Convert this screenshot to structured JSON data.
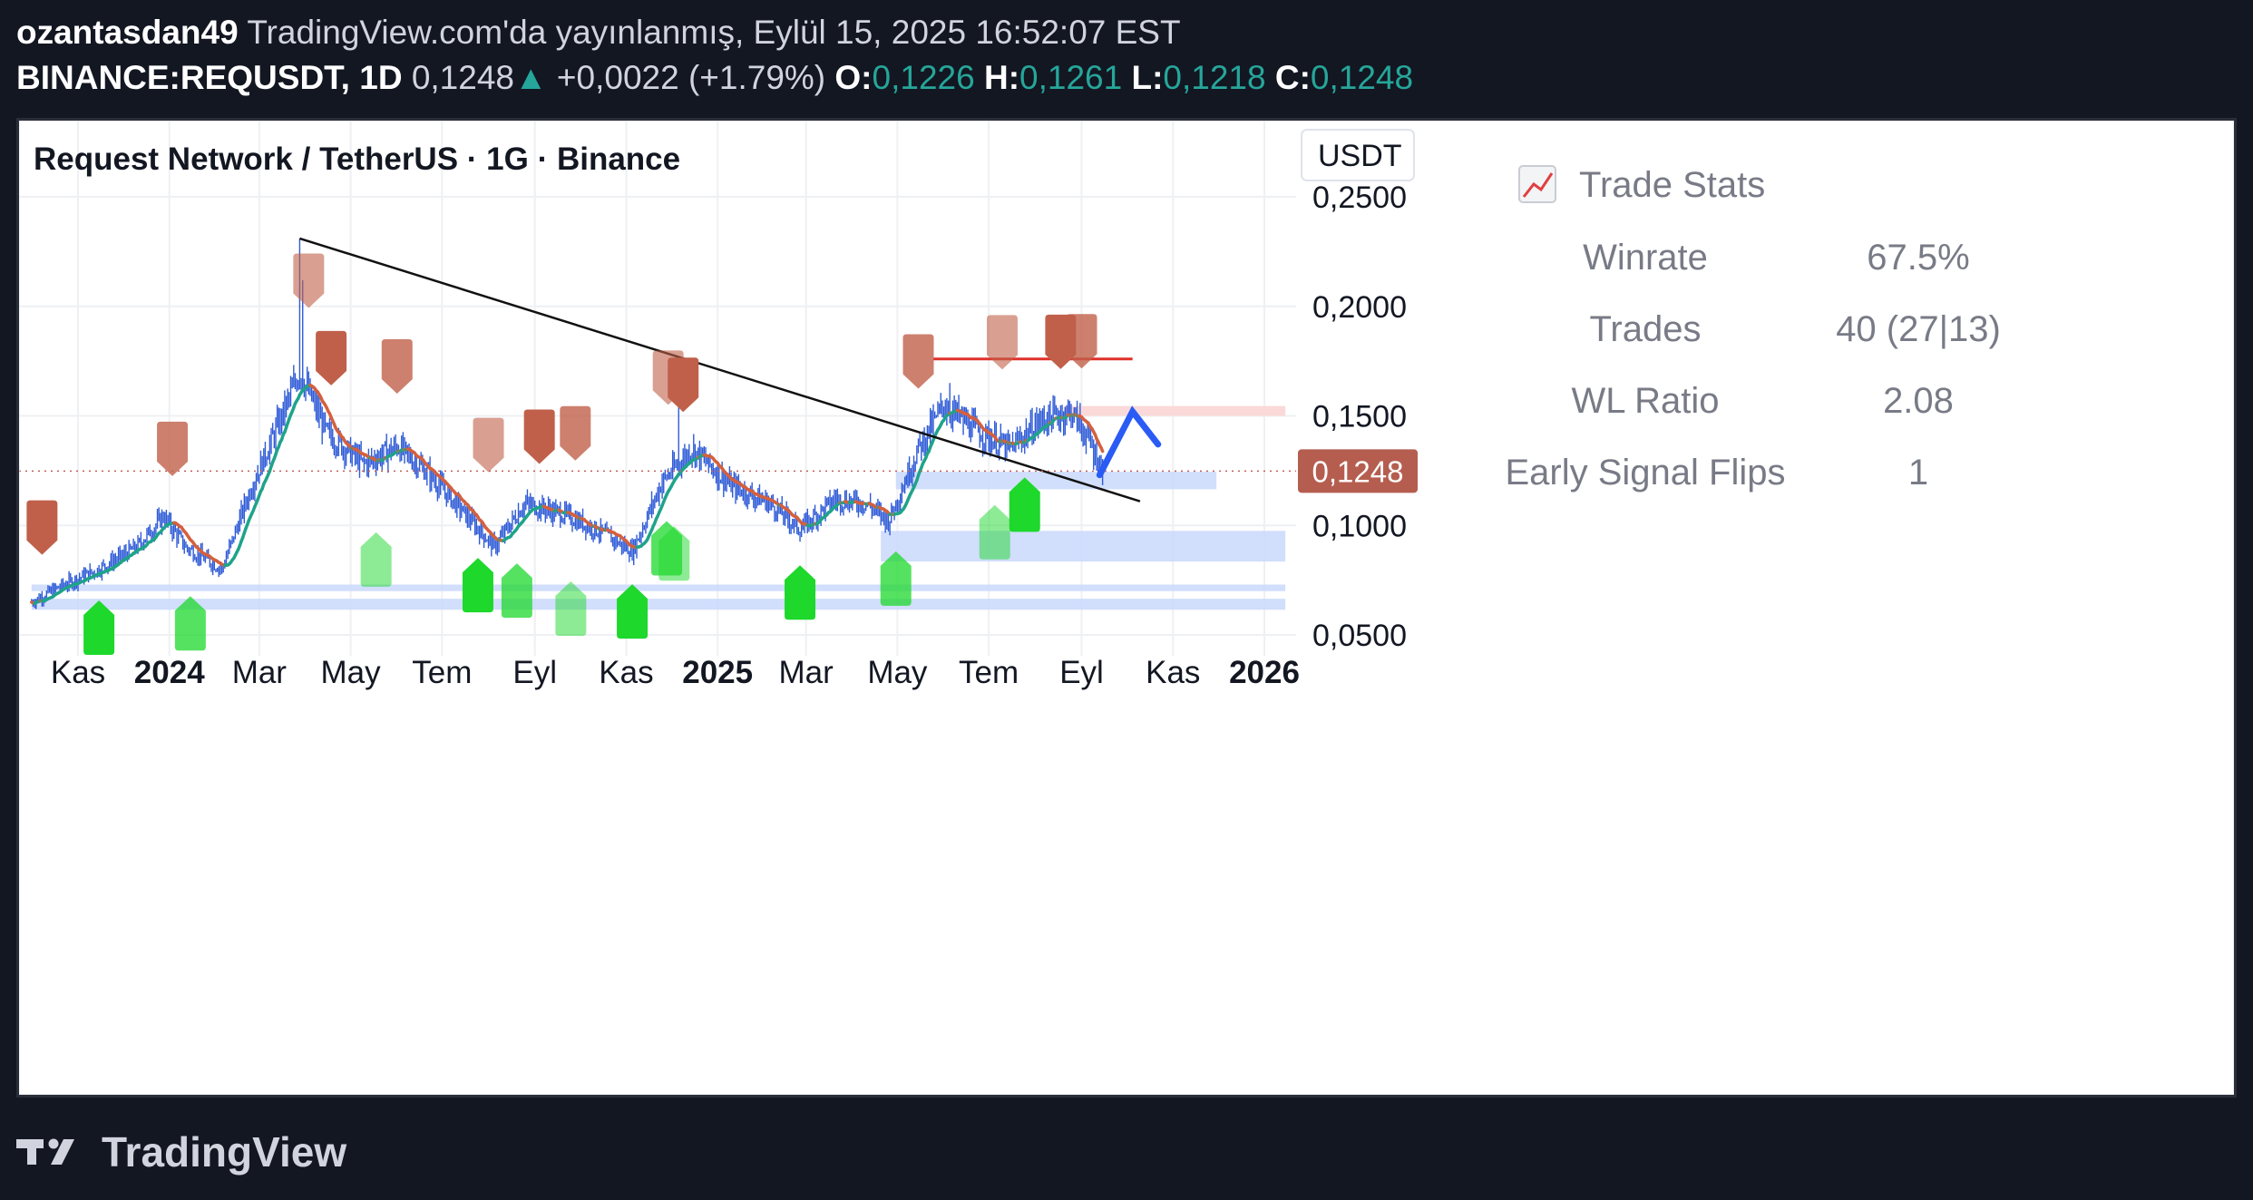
{
  "header": {
    "author": "ozantasdan49",
    "published": "TradingView.com'da yayınlanmış, Eylül 15, 2025 16:52:07 EST",
    "symbol": "BINANCE:REQUSDT, 1D",
    "last": "0,1248",
    "change_arrow": "▲",
    "change": "+0,0022 (+1.79%)",
    "o_label": "O:",
    "o_value": "0,1226",
    "h_label": "H:",
    "h_value": "0,1261",
    "l_label": "L:",
    "l_value": "0,1218",
    "c_label": "C:",
    "c_value": "0,1248"
  },
  "chart_data": {
    "type": "candlestick",
    "title": "Request Network / TetherUS · 1G · Binance",
    "currency_button": "USDT",
    "y_ticks": [
      "0,2500",
      "0,2000",
      "0,1500",
      "0,1000",
      "0,0500"
    ],
    "y_tick_values": [
      0.25,
      0.2,
      0.15,
      0.1,
      0.05
    ],
    "ylim": [
      0.045,
      0.28
    ],
    "x_ticks": [
      "Kas",
      "2024",
      "Mar",
      "May",
      "Tem",
      "Eyl",
      "Kas",
      "2025",
      "Mar",
      "May",
      "Tem",
      "Eyl",
      "Kas",
      "2026"
    ],
    "x_tick_dates": [
      "2023-11-01",
      "2024-01-01",
      "2024-03-01",
      "2024-05-01",
      "2024-07-01",
      "2024-09-01",
      "2024-11-01",
      "2025-01-01",
      "2025-03-01",
      "2025-05-01",
      "2025-07-01",
      "2025-09-01",
      "2025-11-01",
      "2026-01-01"
    ],
    "bold_x_ticks": [
      "2024",
      "2025",
      "2026"
    ],
    "x_range": [
      "2023-10-01",
      "2026-01-15"
    ],
    "current_price_label": "0,1248",
    "current_price": 0.1248,
    "price_path": [
      [
        "2023-10-01",
        0.065
      ],
      [
        "2023-10-20",
        0.072
      ],
      [
        "2023-11-15",
        0.08
      ],
      [
        "2023-12-10",
        0.09
      ],
      [
        "2023-12-28",
        0.104
      ],
      [
        "2024-01-12",
        0.09
      ],
      [
        "2024-02-05",
        0.08
      ],
      [
        "2024-02-25",
        0.118
      ],
      [
        "2024-03-10",
        0.14
      ],
      [
        "2024-03-28",
        0.17
      ],
      [
        "2024-04-15",
        0.142
      ],
      [
        "2024-05-10",
        0.128
      ],
      [
        "2024-06-01",
        0.136
      ],
      [
        "2024-06-20",
        0.125
      ],
      [
        "2024-07-10",
        0.11
      ],
      [
        "2024-08-05",
        0.09
      ],
      [
        "2024-08-25",
        0.11
      ],
      [
        "2024-09-20",
        0.105
      ],
      [
        "2024-10-15",
        0.097
      ],
      [
        "2024-11-05",
        0.088
      ],
      [
        "2024-11-25",
        0.12
      ],
      [
        "2024-12-15",
        0.135
      ],
      [
        "2025-01-10",
        0.118
      ],
      [
        "2025-02-05",
        0.11
      ],
      [
        "2025-02-25",
        0.098
      ],
      [
        "2025-03-20",
        0.112
      ],
      [
        "2025-04-10",
        0.11
      ],
      [
        "2025-04-25",
        0.102
      ],
      [
        "2025-05-15",
        0.135
      ],
      [
        "2025-06-01",
        0.155
      ],
      [
        "2025-06-25",
        0.142
      ],
      [
        "2025-07-15",
        0.135
      ],
      [
        "2025-08-05",
        0.148
      ],
      [
        "2025-08-25",
        0.152
      ],
      [
        "2025-09-05",
        0.14
      ],
      [
        "2025-09-15",
        0.1248
      ]
    ],
    "trendline": {
      "from": [
        "2024-03-28",
        0.231
      ],
      "to": [
        "2025-10-10",
        0.111
      ]
    },
    "support_zones": [
      {
        "from": "2025-04-30",
        "to": "2025-11-30",
        "low": 0.1165,
        "high": 0.1245
      },
      {
        "from": "2025-04-20",
        "to": "2026-01-15",
        "low": 0.0835,
        "high": 0.0975
      },
      {
        "from": "2023-10-01",
        "to": "2026-01-15",
        "low": 0.07,
        "high": 0.073
      },
      {
        "from": "2023-10-01",
        "to": "2026-01-15",
        "low": 0.0615,
        "high": 0.0665
      }
    ],
    "resistance_zone": {
      "from": "2025-08-20",
      "to": "2026-01-15",
      "low": 0.15,
      "high": 0.1545
    },
    "red_level": {
      "from": "2025-05-25",
      "to": "2025-10-05",
      "value": 0.176
    },
    "buy_signals": [
      "2023-11-15",
      "2024-01-15",
      "2024-05-18",
      "2024-07-25",
      "2024-08-20",
      "2024-09-25",
      "2024-11-05",
      "2024-11-28",
      "2024-12-03",
      "2025-02-25",
      "2025-04-30",
      "2025-07-05",
      "2025-07-25"
    ],
    "sell_signals": [
      "2023-10-08",
      "2024-01-03",
      "2024-04-03",
      "2024-04-18",
      "2024-06-01",
      "2024-08-01",
      "2024-09-04",
      "2024-09-28",
      "2024-11-29",
      "2024-12-09",
      "2025-05-15",
      "2025-07-10",
      "2025-08-18",
      "2025-09-01"
    ],
    "projection_arrow": {
      "from": [
        "2025-09-13",
        0.123
      ],
      "mid": [
        "2025-10-05",
        0.152
      ],
      "to": [
        "2025-10-22",
        0.137
      ]
    },
    "stats_panel": {
      "title": "Trade Stats",
      "icon": "chart-line-icon",
      "rows": [
        {
          "label": "Winrate",
          "value": "67.5%"
        },
        {
          "label": "Trades",
          "value": "40 (27|13)"
        },
        {
          "label": "WL Ratio",
          "value": "2.08"
        },
        {
          "label": "Early Signal Flips",
          "value": "1"
        }
      ]
    },
    "colors": {
      "candle": "#2f5bd6",
      "ma_bull": "#1fa38a",
      "ma_bear": "#d4603f",
      "buy": "#1ed82c",
      "sell": "#c0604a",
      "zone": "#c9d8fb",
      "resistance": "#fbd9d9",
      "red_level": "#e0302a",
      "price_label": "#b55e4f",
      "arrow": "#2a5bf5"
    },
    "grid": true
  },
  "footer": {
    "logo_text": "TradingView"
  }
}
